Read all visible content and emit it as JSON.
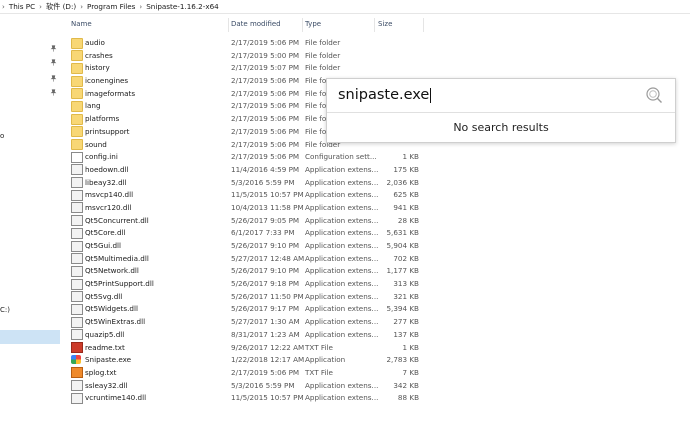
{
  "breadcrumb": [
    "This PC",
    "软件 (D:)",
    "Program Files",
    "Snipaste-1.16.2-x64"
  ],
  "nav_fragments": {
    "top": "o",
    "drive": "C:)"
  },
  "columns": {
    "name": "Name",
    "date": "Date modified",
    "type": "Type",
    "size": "Size"
  },
  "files": [
    {
      "name": "audio",
      "date": "2/17/2019 5:06 PM",
      "type": "File folder",
      "size": "",
      "icon": "folder-icon"
    },
    {
      "name": "crashes",
      "date": "2/17/2019 5:00 PM",
      "type": "File folder",
      "size": "",
      "icon": "folder-icon"
    },
    {
      "name": "history",
      "date": "2/17/2019 5:07 PM",
      "type": "File folder",
      "size": "",
      "icon": "folder-icon"
    },
    {
      "name": "iconengines",
      "date": "2/17/2019 5:06 PM",
      "type": "File fo",
      "size": "",
      "icon": "folder-icon"
    },
    {
      "name": "imageformats",
      "date": "2/17/2019 5:06 PM",
      "type": "File fo",
      "size": "",
      "icon": "folder-icon"
    },
    {
      "name": "lang",
      "date": "2/17/2019 5:06 PM",
      "type": "File fo",
      "size": "",
      "icon": "folder-icon"
    },
    {
      "name": "platforms",
      "date": "2/17/2019 5:06 PM",
      "type": "File fo",
      "size": "",
      "icon": "folder-icon"
    },
    {
      "name": "printsupport",
      "date": "2/17/2019 5:06 PM",
      "type": "File fo",
      "size": "",
      "icon": "folder-icon"
    },
    {
      "name": "sound",
      "date": "2/17/2019 5:06 PM",
      "type": "File folder",
      "size": "",
      "icon": "folder-icon"
    },
    {
      "name": "config.ini",
      "date": "2/17/2019 5:06 PM",
      "type": "Configuration sett...",
      "size": "1 KB",
      "icon": "settings-file-icon"
    },
    {
      "name": "hoedown.dll",
      "date": "11/4/2016 4:59 PM",
      "type": "Application extens...",
      "size": "175 KB",
      "icon": "dll-icon"
    },
    {
      "name": "libeay32.dll",
      "date": "5/3/2016 5:59 PM",
      "type": "Application extens...",
      "size": "2,036 KB",
      "icon": "dll-icon"
    },
    {
      "name": "msvcp140.dll",
      "date": "11/5/2015 10:57 PM",
      "type": "Application extens...",
      "size": "625 KB",
      "icon": "dll-icon"
    },
    {
      "name": "msvcr120.dll",
      "date": "10/4/2013 11:58 PM",
      "type": "Application extens...",
      "size": "941 KB",
      "icon": "dll-icon"
    },
    {
      "name": "Qt5Concurrent.dll",
      "date": "5/26/2017 9:05 PM",
      "type": "Application extens...",
      "size": "28 KB",
      "icon": "dll-icon"
    },
    {
      "name": "Qt5Core.dll",
      "date": "6/1/2017 7:33 PM",
      "type": "Application extens...",
      "size": "5,631 KB",
      "icon": "dll-icon"
    },
    {
      "name": "Qt5Gui.dll",
      "date": "5/26/2017 9:10 PM",
      "type": "Application extens...",
      "size": "5,904 KB",
      "icon": "dll-icon"
    },
    {
      "name": "Qt5Multimedia.dll",
      "date": "5/27/2017 12:48 AM",
      "type": "Application extens...",
      "size": "702 KB",
      "icon": "dll-icon"
    },
    {
      "name": "Qt5Network.dll",
      "date": "5/26/2017 9:10 PM",
      "type": "Application extens...",
      "size": "1,177 KB",
      "icon": "dll-icon"
    },
    {
      "name": "Qt5PrintSupport.dll",
      "date": "5/26/2017 9:18 PM",
      "type": "Application extens...",
      "size": "313 KB",
      "icon": "dll-icon"
    },
    {
      "name": "Qt5Svg.dll",
      "date": "5/26/2017 11:50 PM",
      "type": "Application extens...",
      "size": "321 KB",
      "icon": "dll-icon"
    },
    {
      "name": "Qt5Widgets.dll",
      "date": "5/26/2017 9:17 PM",
      "type": "Application extens...",
      "size": "5,394 KB",
      "icon": "dll-icon"
    },
    {
      "name": "Qt5WinExtras.dll",
      "date": "5/27/2017 1:30 AM",
      "type": "Application extens...",
      "size": "277 KB",
      "icon": "dll-icon"
    },
    {
      "name": "quazip5.dll",
      "date": "8/31/2017 1:23 AM",
      "type": "Application extens...",
      "size": "137 KB",
      "icon": "dll-icon"
    },
    {
      "name": "readme.txt",
      "date": "9/26/2017 12:22 AM",
      "type": "TXT File",
      "size": "1 KB",
      "icon": "text-file-icon"
    },
    {
      "name": "Snipaste.exe",
      "date": "1/22/2018 12:17 AM",
      "type": "Application",
      "size": "2,783 KB",
      "icon": "snipaste-app-icon"
    },
    {
      "name": "splog.txt",
      "date": "2/17/2019 5:06 PM",
      "type": "TXT File",
      "size": "7 KB",
      "icon": "text-file-icon"
    },
    {
      "name": "ssleay32.dll",
      "date": "5/3/2016 5:59 PM",
      "type": "Application extens...",
      "size": "342 KB",
      "icon": "dll-icon"
    },
    {
      "name": "vcruntime140.dll",
      "date": "11/5/2015 10:57 PM",
      "type": "Application extens...",
      "size": "88 KB",
      "icon": "dll-icon"
    }
  ],
  "search_popup": {
    "query": "snipaste.exe",
    "message": "No search results"
  }
}
